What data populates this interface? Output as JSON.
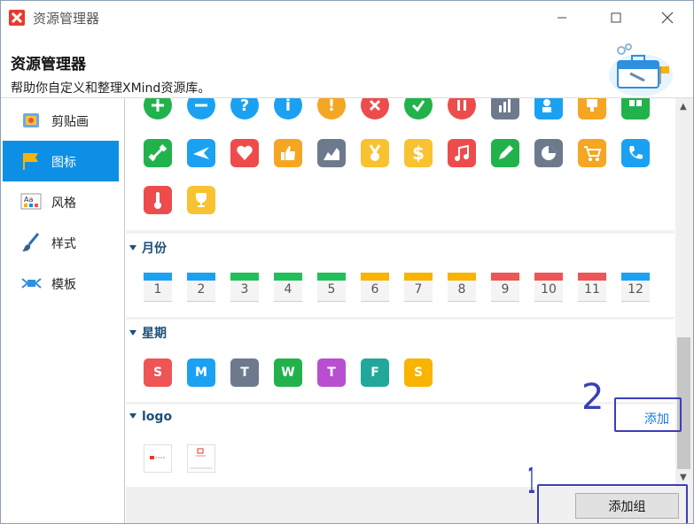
{
  "window": {
    "title": "资源管理器"
  },
  "header": {
    "title": "资源管理器",
    "subtitle": "帮助你自定义和整理XMind资源库。"
  },
  "sidebar": {
    "items": [
      {
        "label": "剪贴画",
        "icon": "clipart-icon"
      },
      {
        "label": "图标",
        "icon": "flag-icon",
        "active": true
      },
      {
        "label": "风格",
        "icon": "style-icon"
      },
      {
        "label": "样式",
        "icon": "brush-icon"
      },
      {
        "label": "模板",
        "icon": "template-icon"
      }
    ]
  },
  "sections": {
    "months": {
      "title": "月份",
      "items": [
        "1",
        "2",
        "3",
        "4",
        "5",
        "6",
        "7",
        "8",
        "9",
        "10",
        "11",
        "12"
      ]
    },
    "weekdays": {
      "title": "星期",
      "items": [
        "S",
        "M",
        "T",
        "W",
        "T",
        "F",
        "S"
      ]
    },
    "logo": {
      "title": "logo",
      "add_label": "添加"
    }
  },
  "footer": {
    "add_group_label": "添加组"
  },
  "annotations": {
    "one": "1",
    "two": "2"
  },
  "colors": {
    "accent": "#0e8fe6",
    "annotation": "#3a3fb8"
  }
}
